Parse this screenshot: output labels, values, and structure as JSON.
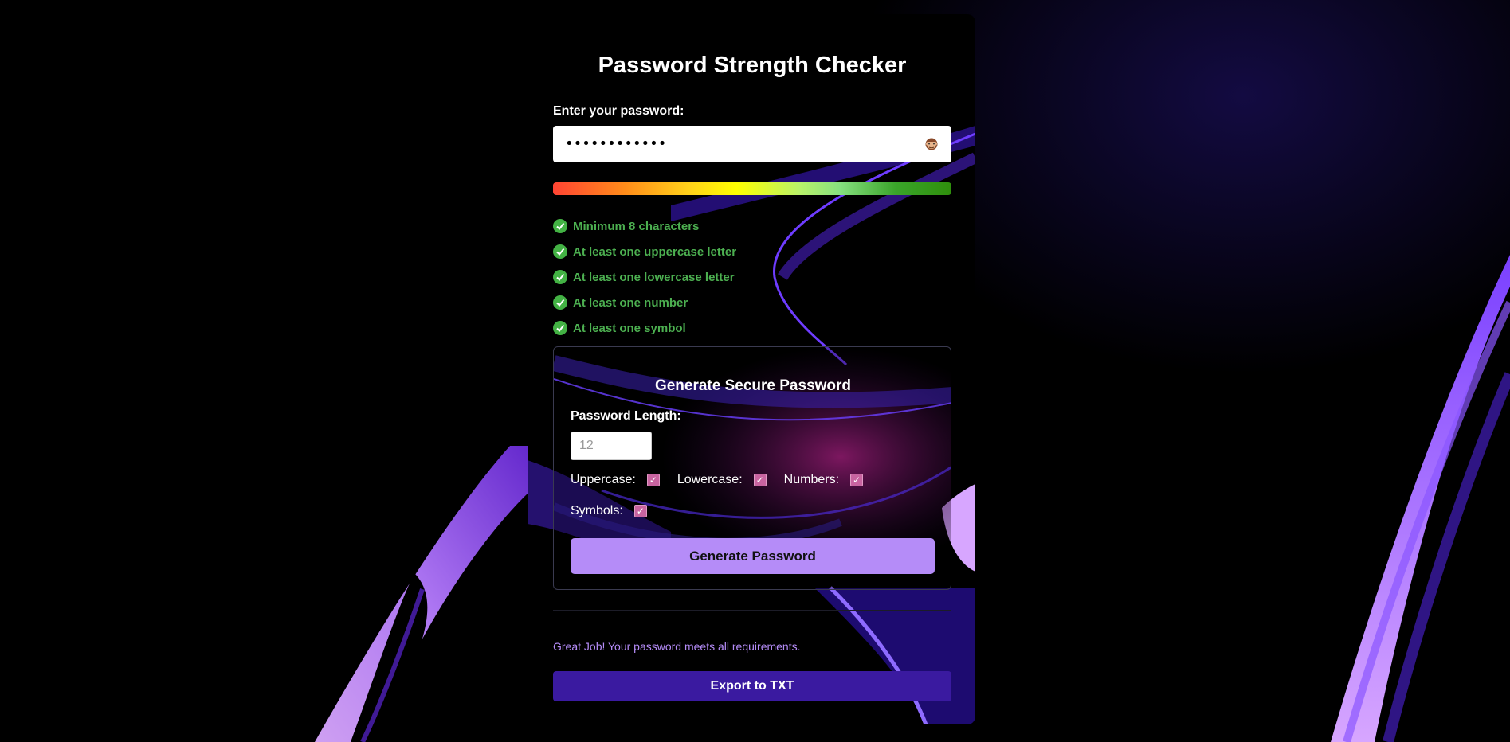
{
  "header": {
    "title": "Password Strength Checker"
  },
  "password": {
    "label": "Enter your password:",
    "masked_value": "••••••••••••",
    "toggle_icon": "monkey-see-no-evil-icon"
  },
  "strength_meter": {
    "level": 1.0
  },
  "requirements": [
    {
      "label": "Minimum 8 characters",
      "met": true
    },
    {
      "label": "At least one uppercase letter",
      "met": true
    },
    {
      "label": "At least one lowercase letter",
      "met": true
    },
    {
      "label": "At least one number",
      "met": true
    },
    {
      "label": "At least one symbol",
      "met": true
    }
  ],
  "generator": {
    "title": "Generate Secure Password",
    "length_label": "Password Length:",
    "length_placeholder": "12",
    "options": {
      "uppercase": {
        "label": "Uppercase:",
        "checked": true
      },
      "lowercase": {
        "label": "Lowercase:",
        "checked": true
      },
      "numbers": {
        "label": "Numbers:",
        "checked": true
      },
      "symbols": {
        "label": "Symbols:",
        "checked": true
      }
    },
    "button_label": "Generate Password"
  },
  "status": {
    "message": "Great Job! Your password meets all requirements."
  },
  "export": {
    "button_label": "Export to TXT"
  },
  "colors": {
    "accent": "#b58cf8",
    "success": "#4caf50",
    "export_button": "#3a1aa0",
    "checkbox": "#c864a0"
  }
}
